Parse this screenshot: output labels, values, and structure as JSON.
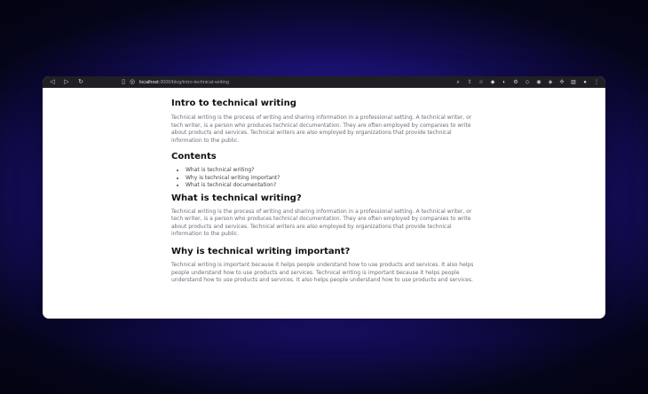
{
  "browser": {
    "url_host": "localhost",
    "url_path": ":3000/blog/intro-technical-writing",
    "icons": {
      "back": "arrow-left-icon",
      "forward": "arrow-right-icon",
      "reload": "reload-icon"
    }
  },
  "article": {
    "title": "Intro to technical writing",
    "intro": "Technical writing is the process of writing and sharing information in a professional setting. A technical writer, or tech writer, is a person who produces technical documentation. They are often employed by companies to write about products and services. Technical writers are also employed by organizations that provide technical information to the public.",
    "contents_heading": "Contents",
    "contents": [
      "What is technical writing?",
      "Why is technical writing important?",
      "What is technical documentation?"
    ],
    "sections": [
      {
        "heading": "What is technical writing?",
        "body": "Technical writing is the process of writing and sharing information in a professional setting. A technical writer, or tech writer, is a person who produces technical documentation. They are often employed by companies to write about products and services. Technical writers are also employed by organizations that provide technical information to the public."
      },
      {
        "heading": "Why is technical writing important?",
        "body": "Technical writing is important because it helps people understand how to use products and services. It also helps people understand how to use products and services. Technical writing is important because it helps people understand how to use products and services. It also helps people understand how to use products and services."
      }
    ]
  }
}
